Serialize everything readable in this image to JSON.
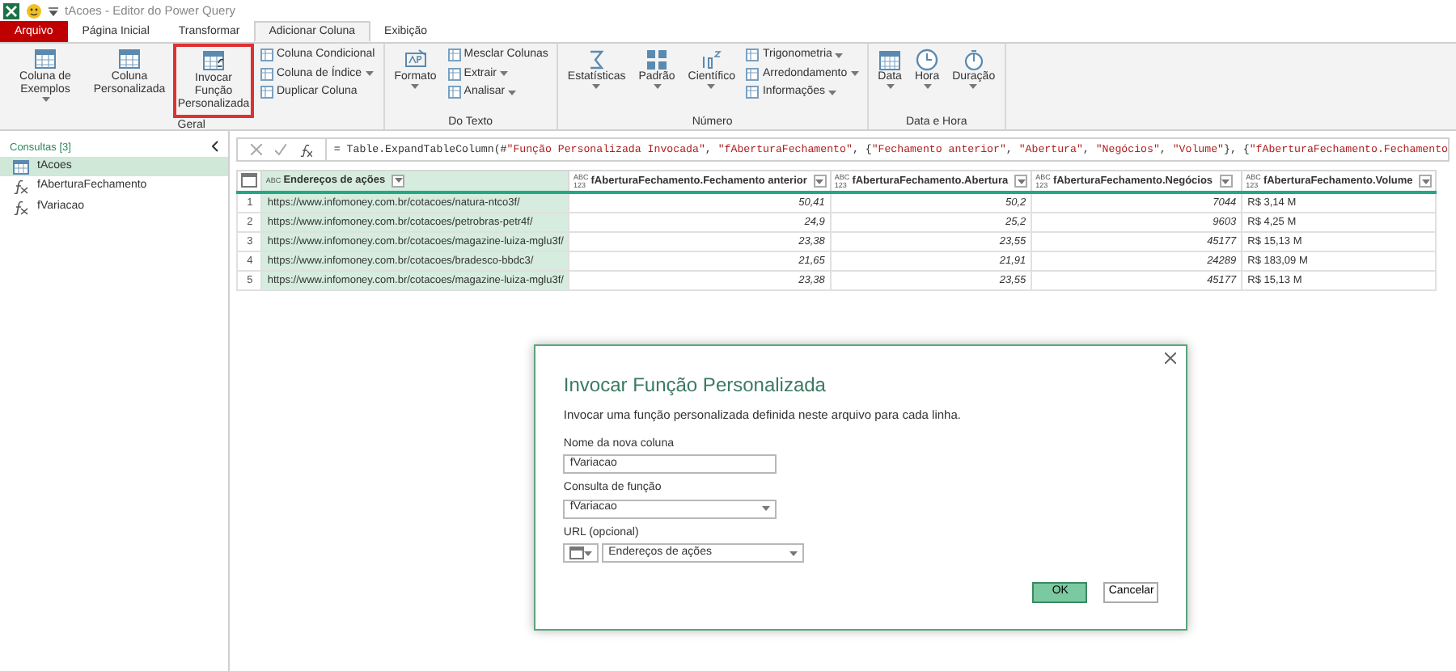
{
  "window": {
    "title": "tAcoes - Editor do Power Query"
  },
  "tabs": [
    {
      "label": "Arquivo",
      "kind": "file",
      "selected": false
    },
    {
      "label": "Página Inicial",
      "kind": "tab",
      "selected": false
    },
    {
      "label": "Transformar",
      "kind": "tab",
      "selected": false
    },
    {
      "label": "Adicionar Coluna",
      "kind": "tab",
      "selected": true
    },
    {
      "label": "Exibição",
      "kind": "tab",
      "selected": false
    }
  ],
  "ribbon": {
    "groups": [
      {
        "label": "Geral",
        "items": [
          {
            "label": "Coluna de Exemplos",
            "kind": "large",
            "dropdown": true,
            "highlighted": false
          },
          {
            "label": "Coluna Personalizada",
            "kind": "large",
            "dropdown": false,
            "highlighted": false
          },
          {
            "label": "Invocar Função Personalizada",
            "kind": "large",
            "dropdown": false,
            "highlighted": true
          },
          {
            "label": "Coluna Condicional",
            "kind": "small",
            "dropdown": false
          },
          {
            "label": "Coluna de Índice",
            "kind": "small",
            "dropdown": true
          },
          {
            "label": "Duplicar Coluna",
            "kind": "small",
            "dropdown": false
          }
        ]
      },
      {
        "label": "Do Texto",
        "items": [
          {
            "label": "Formato",
            "kind": "large",
            "dropdown": true,
            "highlighted": false
          },
          {
            "label": "Mesclar Colunas",
            "kind": "small",
            "dropdown": false
          },
          {
            "label": "Extrair",
            "kind": "small",
            "dropdown": true
          },
          {
            "label": "Analisar",
            "kind": "small",
            "dropdown": true
          }
        ]
      },
      {
        "label": "Número",
        "items": [
          {
            "label": "Estatísticas",
            "kind": "large",
            "dropdown": true,
            "highlighted": false
          },
          {
            "label": "Padrão",
            "kind": "large",
            "dropdown": true,
            "highlighted": false
          },
          {
            "label": "Científico",
            "kind": "large",
            "dropdown": true,
            "highlighted": false
          },
          {
            "label": "Trigonometria",
            "kind": "small",
            "dropdown": true
          },
          {
            "label": "Arredondamento",
            "kind": "small",
            "dropdown": true
          },
          {
            "label": "Informações",
            "kind": "small",
            "dropdown": true
          }
        ]
      },
      {
        "label": "Data e Hora",
        "items": [
          {
            "label": "Data",
            "kind": "large",
            "dropdown": true,
            "highlighted": false
          },
          {
            "label": "Hora",
            "kind": "large",
            "dropdown": true,
            "highlighted": false
          },
          {
            "label": "Duração",
            "kind": "large",
            "dropdown": true,
            "highlighted": false
          }
        ]
      }
    ]
  },
  "queries": {
    "header": "Consultas [3]",
    "items": [
      {
        "label": "tAcoes",
        "kind": "table",
        "selected": true
      },
      {
        "label": "fAberturaFechamento",
        "kind": "function",
        "selected": false
      },
      {
        "label": "fVariacao",
        "kind": "function",
        "selected": false
      }
    ]
  },
  "formula_bar": {
    "segments": [
      {
        "text": "= Table.ExpandTableColumn(#",
        "kind": "code"
      },
      {
        "text": "\"Função Personalizada Invocada\"",
        "kind": "string"
      },
      {
        "text": ", ",
        "kind": "code"
      },
      {
        "text": "\"fAberturaFechamento\"",
        "kind": "string"
      },
      {
        "text": ", {",
        "kind": "code"
      },
      {
        "text": "\"Fechamento anterior\"",
        "kind": "string"
      },
      {
        "text": ", ",
        "kind": "code"
      },
      {
        "text": "\"Abertura\"",
        "kind": "string"
      },
      {
        "text": ", ",
        "kind": "code"
      },
      {
        "text": "\"Negócios\"",
        "kind": "string"
      },
      {
        "text": ", ",
        "kind": "code"
      },
      {
        "text": "\"Volume\"",
        "kind": "string"
      },
      {
        "text": "}, {",
        "kind": "code"
      },
      {
        "text": "\"fAberturaFechamento.Fechamento",
        "kind": "string"
      }
    ]
  },
  "table": {
    "columns": [
      {
        "label": "Endereços de ações",
        "type_label": "ABC",
        "kind": "text",
        "selected": true
      },
      {
        "label": "fAberturaFechamento.Fechamento anterior",
        "type_label": "ABC 123",
        "kind": "number",
        "selected": false
      },
      {
        "label": "fAberturaFechamento.Abertura",
        "type_label": "ABC 123",
        "kind": "number",
        "selected": false
      },
      {
        "label": "fAberturaFechamento.Negócios",
        "type_label": "ABC 123",
        "kind": "number",
        "selected": false
      },
      {
        "label": "fAberturaFechamento.Volume",
        "type_label": "ABC 123",
        "kind": "text",
        "selected": false
      }
    ],
    "rows": [
      {
        "number": "1",
        "cells": [
          "https://www.infomoney.com.br/cotacoes/natura-ntco3f/",
          "50,41",
          "50,2",
          "7044",
          "R$ 3,14 M"
        ]
      },
      {
        "number": "2",
        "cells": [
          "https://www.infomoney.com.br/cotacoes/petrobras-petr4f/",
          "24,9",
          "25,2",
          "9603",
          "R$ 4,25 M"
        ]
      },
      {
        "number": "3",
        "cells": [
          "https://www.infomoney.com.br/cotacoes/magazine-luiza-mglu3f/",
          "23,38",
          "23,55",
          "45177",
          "R$ 15,13 M"
        ]
      },
      {
        "number": "4",
        "cells": [
          "https://www.infomoney.com.br/cotacoes/bradesco-bbdc3/",
          "21,65",
          "21,91",
          "24289",
          "R$ 183,09 M"
        ]
      },
      {
        "number": "5",
        "cells": [
          "https://www.infomoney.com.br/cotacoes/magazine-luiza-mglu3f/",
          "23,38",
          "23,55",
          "45177",
          "R$ 15,13 M"
        ]
      }
    ]
  },
  "dialog": {
    "title": "Invocar Função Personalizada",
    "description": "Invocar uma função personalizada definida neste arquivo para cada linha.",
    "fields": [
      {
        "label": "Nome da nova coluna",
        "kind": "text",
        "value": "fVariacao"
      },
      {
        "label": "Consulta de função",
        "kind": "dropdown",
        "value": "fVariacao"
      },
      {
        "label": "URL (opcional)",
        "kind": "column_picker",
        "value": "Endereços de ações"
      }
    ],
    "buttons": [
      {
        "label": "OK",
        "kind": "primary"
      },
      {
        "label": "Cancelar",
        "kind": "secondary"
      }
    ]
  }
}
